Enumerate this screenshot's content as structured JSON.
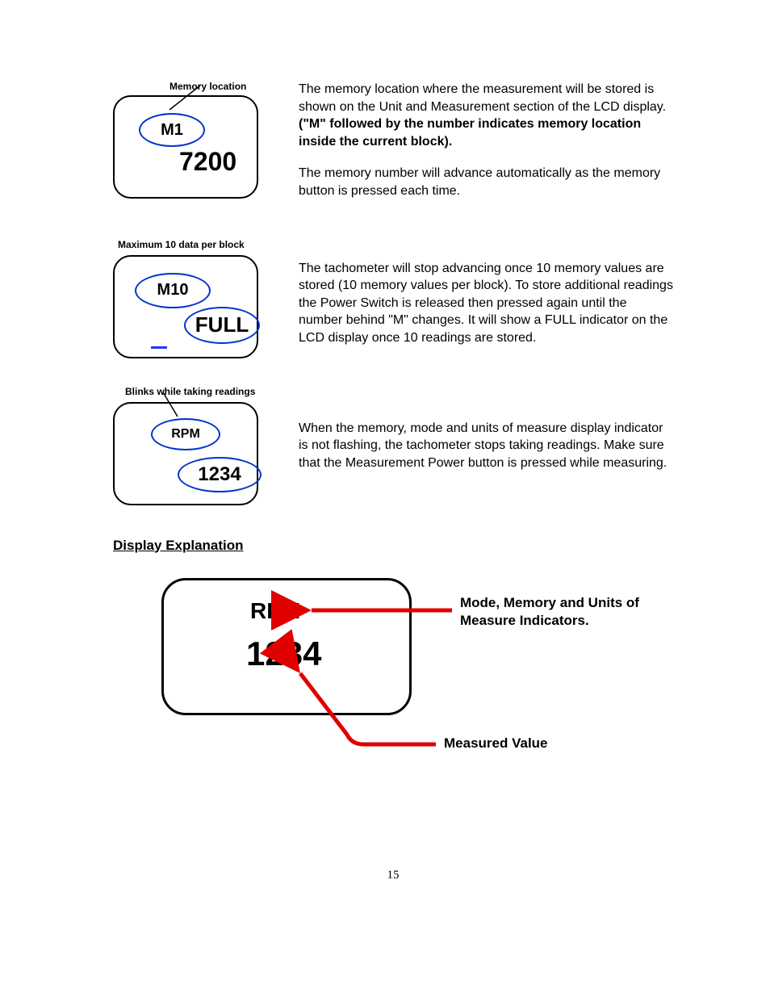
{
  "figure1": {
    "caption": "Memory location",
    "label": "M1",
    "value": "7200"
  },
  "paragraph1a": "The memory location where the measurement will be stored is shown on the Unit and Measurement section of the LCD display.  ",
  "paragraph1b": "(\"M\" followed by the number indicates memory location inside the current block).",
  "paragraph1c": "The memory number will advance automatically as the memory button is pressed each time.",
  "figure2": {
    "caption": "Maximum 10 data per block",
    "label": "M10",
    "value": "FULL"
  },
  "paragraph2": "The tachometer will stop advancing once 10 memory values are stored (10 memory values per block). To store additional readings the Power Switch is released then pressed again until the number behind \"M\" changes.  It will show a FULL indicator on the LCD display once 10 readings are stored.",
  "figure3": {
    "caption": "Blinks while taking readings",
    "label": "RPM",
    "value": "1234"
  },
  "paragraph3": "When the memory, mode and units of measure display indicator is not flashing, the tachometer stops taking readings. Make sure that the Measurement Power button is pressed while measuring.",
  "heading": "Display Explanation",
  "bigFigure": {
    "unit": "RPM",
    "value": "1234",
    "label1": "Mode, Memory and Units of Measure  Indicators.",
    "label2": "Measured Value"
  },
  "pageNumber": "15"
}
